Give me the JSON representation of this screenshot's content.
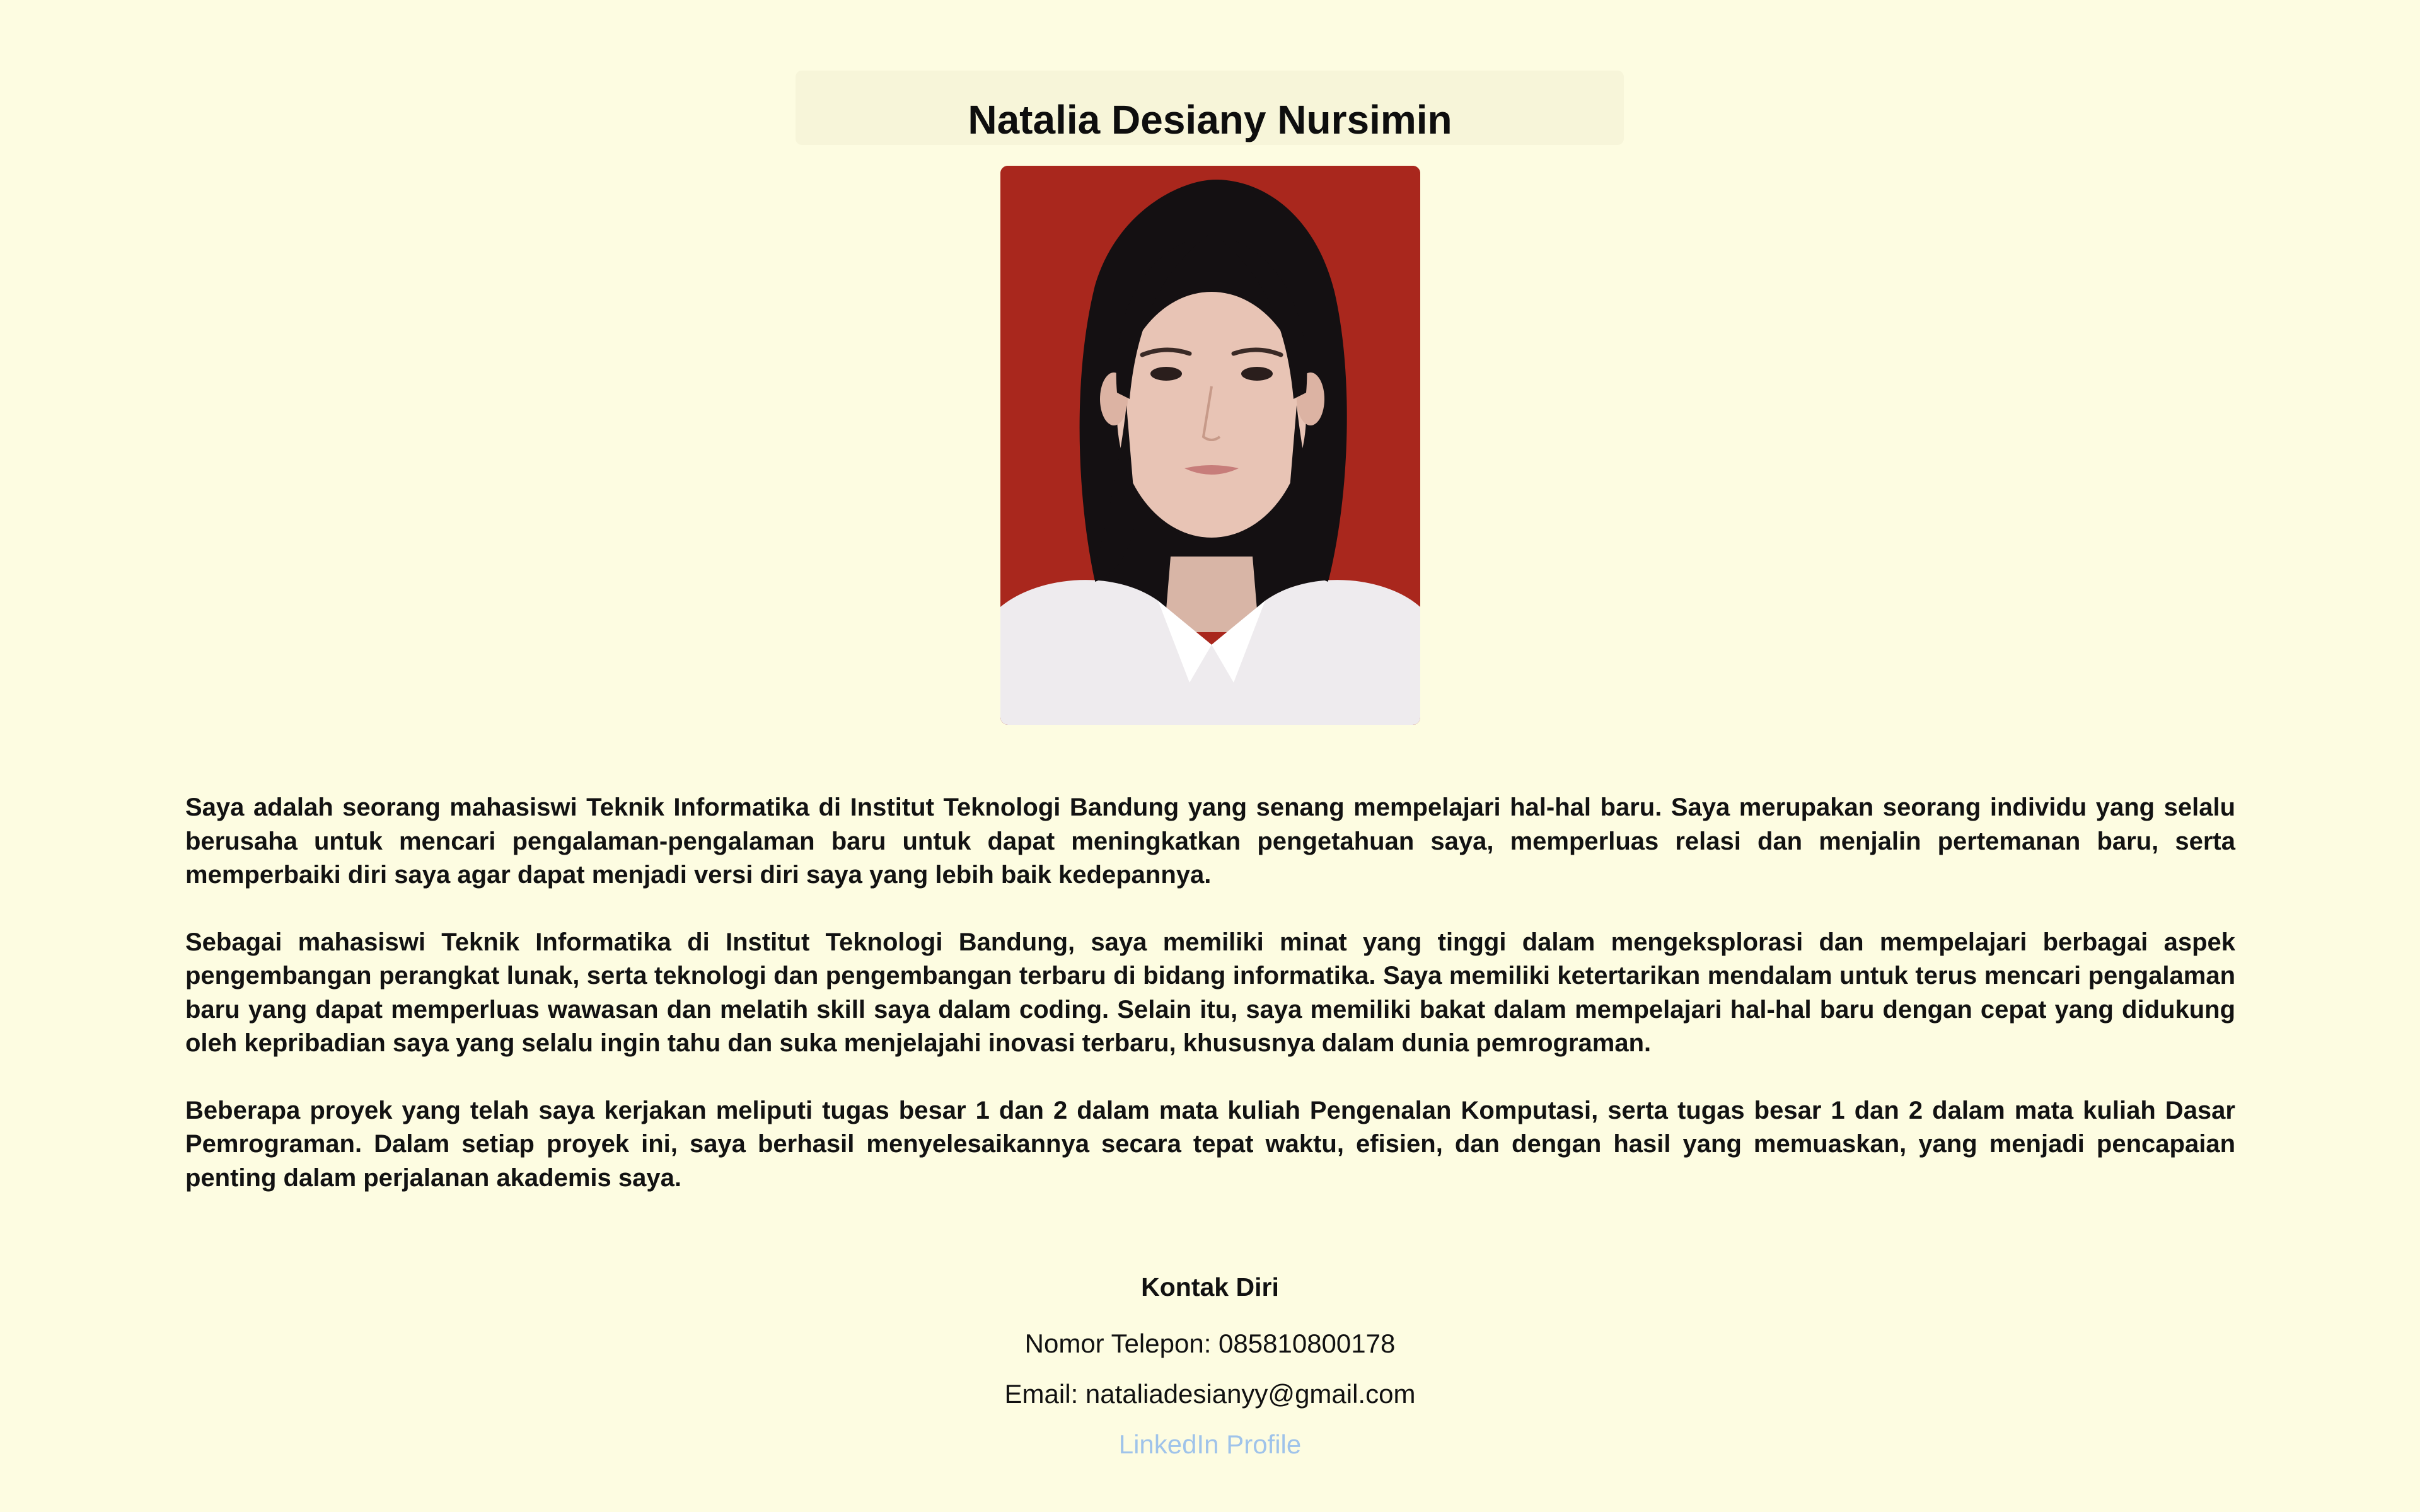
{
  "profile": {
    "name": "Natalia Desiany Nursimin",
    "photo_alt": "Foto Natalia Desiany Nursimin"
  },
  "about": {
    "paragraphs": [
      "Saya adalah seorang mahasiswi Teknik Informatika di Institut Teknologi Bandung yang senang mempelajari hal-hal baru. Saya merupakan seorang individu yang selalu berusaha untuk mencari pengalaman-pengalaman baru untuk dapat meningkatkan pengetahuan saya, memperluas relasi dan menjalin pertemanan baru, serta memperbaiki diri saya agar dapat menjadi versi diri saya yang lebih baik kedepannya.",
      "Sebagai mahasiswi Teknik Informatika di Institut Teknologi Bandung, saya memiliki minat yang tinggi dalam mengeksplorasi dan mempelajari berbagai aspek pengembangan perangkat lunak, serta teknologi dan pengembangan terbaru di bidang informatika. Saya memiliki ketertarikan mendalam untuk terus mencari pengalaman baru yang dapat memperluas wawasan dan melatih skill saya dalam coding. Selain itu, saya memiliki bakat dalam mempelajari hal-hal baru dengan cepat yang didukung oleh kepribadian saya yang selalu ingin tahu dan suka menjelajahi inovasi terbaru, khususnya dalam dunia pemrograman.",
      "Beberapa proyek yang telah saya kerjakan meliputi tugas besar 1 dan 2 dalam mata kuliah Pengenalan Komputasi, serta tugas besar 1 dan 2 dalam mata kuliah Dasar Pemrograman. Dalam setiap proyek ini, saya berhasil menyelesaikannya secara tepat waktu, efisien, dan dengan hasil yang memuaskan, yang menjadi pencapaian penting dalam perjalanan akademis saya."
    ]
  },
  "contact": {
    "title": "Kontak Diri",
    "phone_label": "Nomor Telepon: ",
    "phone_value": "085810800178",
    "email_label": "Email: ",
    "email_value": "nataliadesianyy@gmail.com",
    "linkedin_label": "LinkedIn Profile"
  },
  "colors": {
    "background": "#fdfce1",
    "photo_background": "#a9271d",
    "link": "#9fc3ea",
    "text": "#111111"
  }
}
